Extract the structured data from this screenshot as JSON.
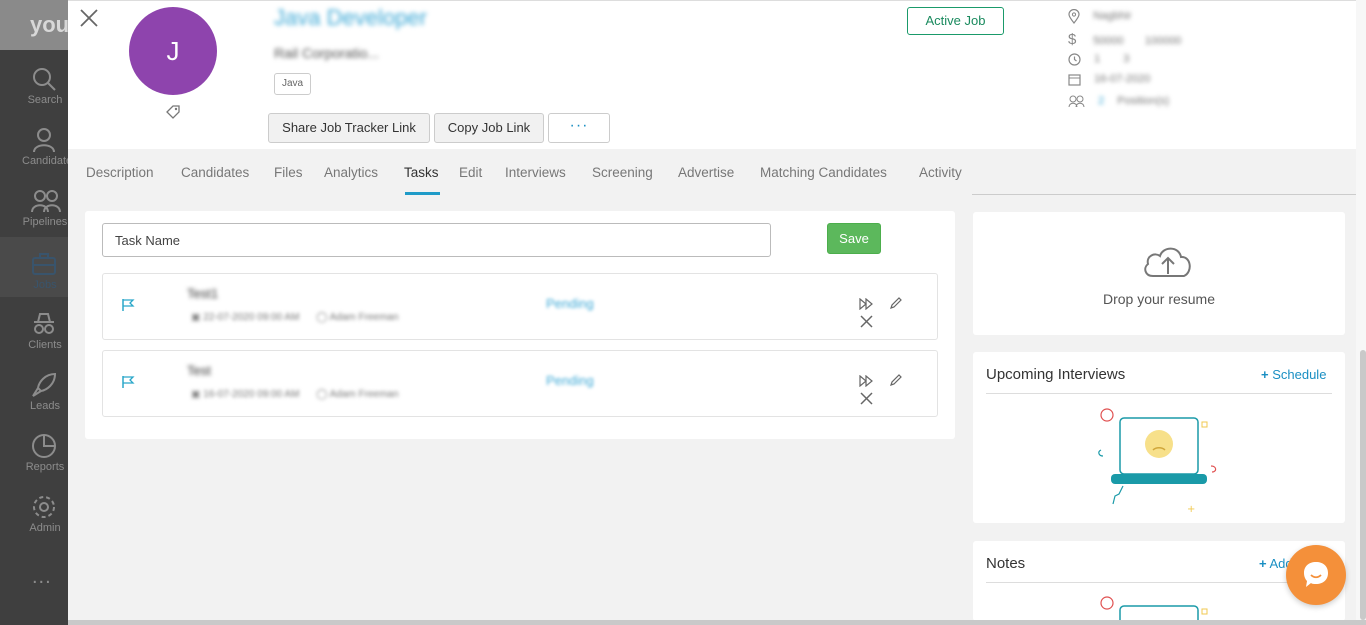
{
  "app": {
    "logo_text": "your"
  },
  "nav": {
    "items": [
      {
        "label": "Search"
      },
      {
        "label": "Candidates"
      },
      {
        "label": "Pipelines"
      },
      {
        "label": "Jobs"
      },
      {
        "label": "Clients"
      },
      {
        "label": "Leads"
      },
      {
        "label": "Reports"
      },
      {
        "label": "Admin"
      }
    ],
    "more": "..."
  },
  "job": {
    "avatar_letter": "J",
    "title": "Java Developer",
    "company": "Rail Corporatio...",
    "skill": "Java",
    "status": "Active Job",
    "meta": {
      "location": "Nagbhir",
      "salary_min": "50000",
      "salary_max": "100000",
      "experience_min": "1",
      "experience_max": "3",
      "date": "16-07-2020",
      "positions_count": "2",
      "positions_label": "Position(s)"
    }
  },
  "header_buttons": {
    "share_tracker": "Share Job Tracker Link",
    "copy_link": "Copy Job Link",
    "more": "···"
  },
  "tabs": [
    {
      "label": "Description"
    },
    {
      "label": "Candidates"
    },
    {
      "label": "Files"
    },
    {
      "label": "Analytics"
    },
    {
      "label": "Tasks"
    },
    {
      "label": "Edit"
    },
    {
      "label": "Interviews"
    },
    {
      "label": "Screening"
    },
    {
      "label": "Advertise"
    },
    {
      "label": "Matching Candidates"
    },
    {
      "label": "Activity"
    }
  ],
  "active_tab": "Tasks",
  "tasks": {
    "input_placeholder": "Task Name",
    "save_label": "Save",
    "items": [
      {
        "title": "Test1",
        "datetime": "22-07-2020 09:00 AM",
        "assignee": "Adam Freeman",
        "status": "Pending"
      },
      {
        "title": "Test",
        "datetime": "16-07-2020 09:00 AM",
        "assignee": "Adam Freeman",
        "status": "Pending"
      }
    ]
  },
  "dropzone": {
    "label": "Drop your resume"
  },
  "upcoming_interviews": {
    "title": "Upcoming Interviews",
    "action": "Schedule"
  },
  "notes": {
    "title": "Notes",
    "action": "Add"
  },
  "colors": {
    "accent": "#1f9bc8",
    "avatar": "#8e44ad",
    "save": "#5cb85c",
    "active_status": "#1a9a6a",
    "chat": "#f4903a"
  }
}
